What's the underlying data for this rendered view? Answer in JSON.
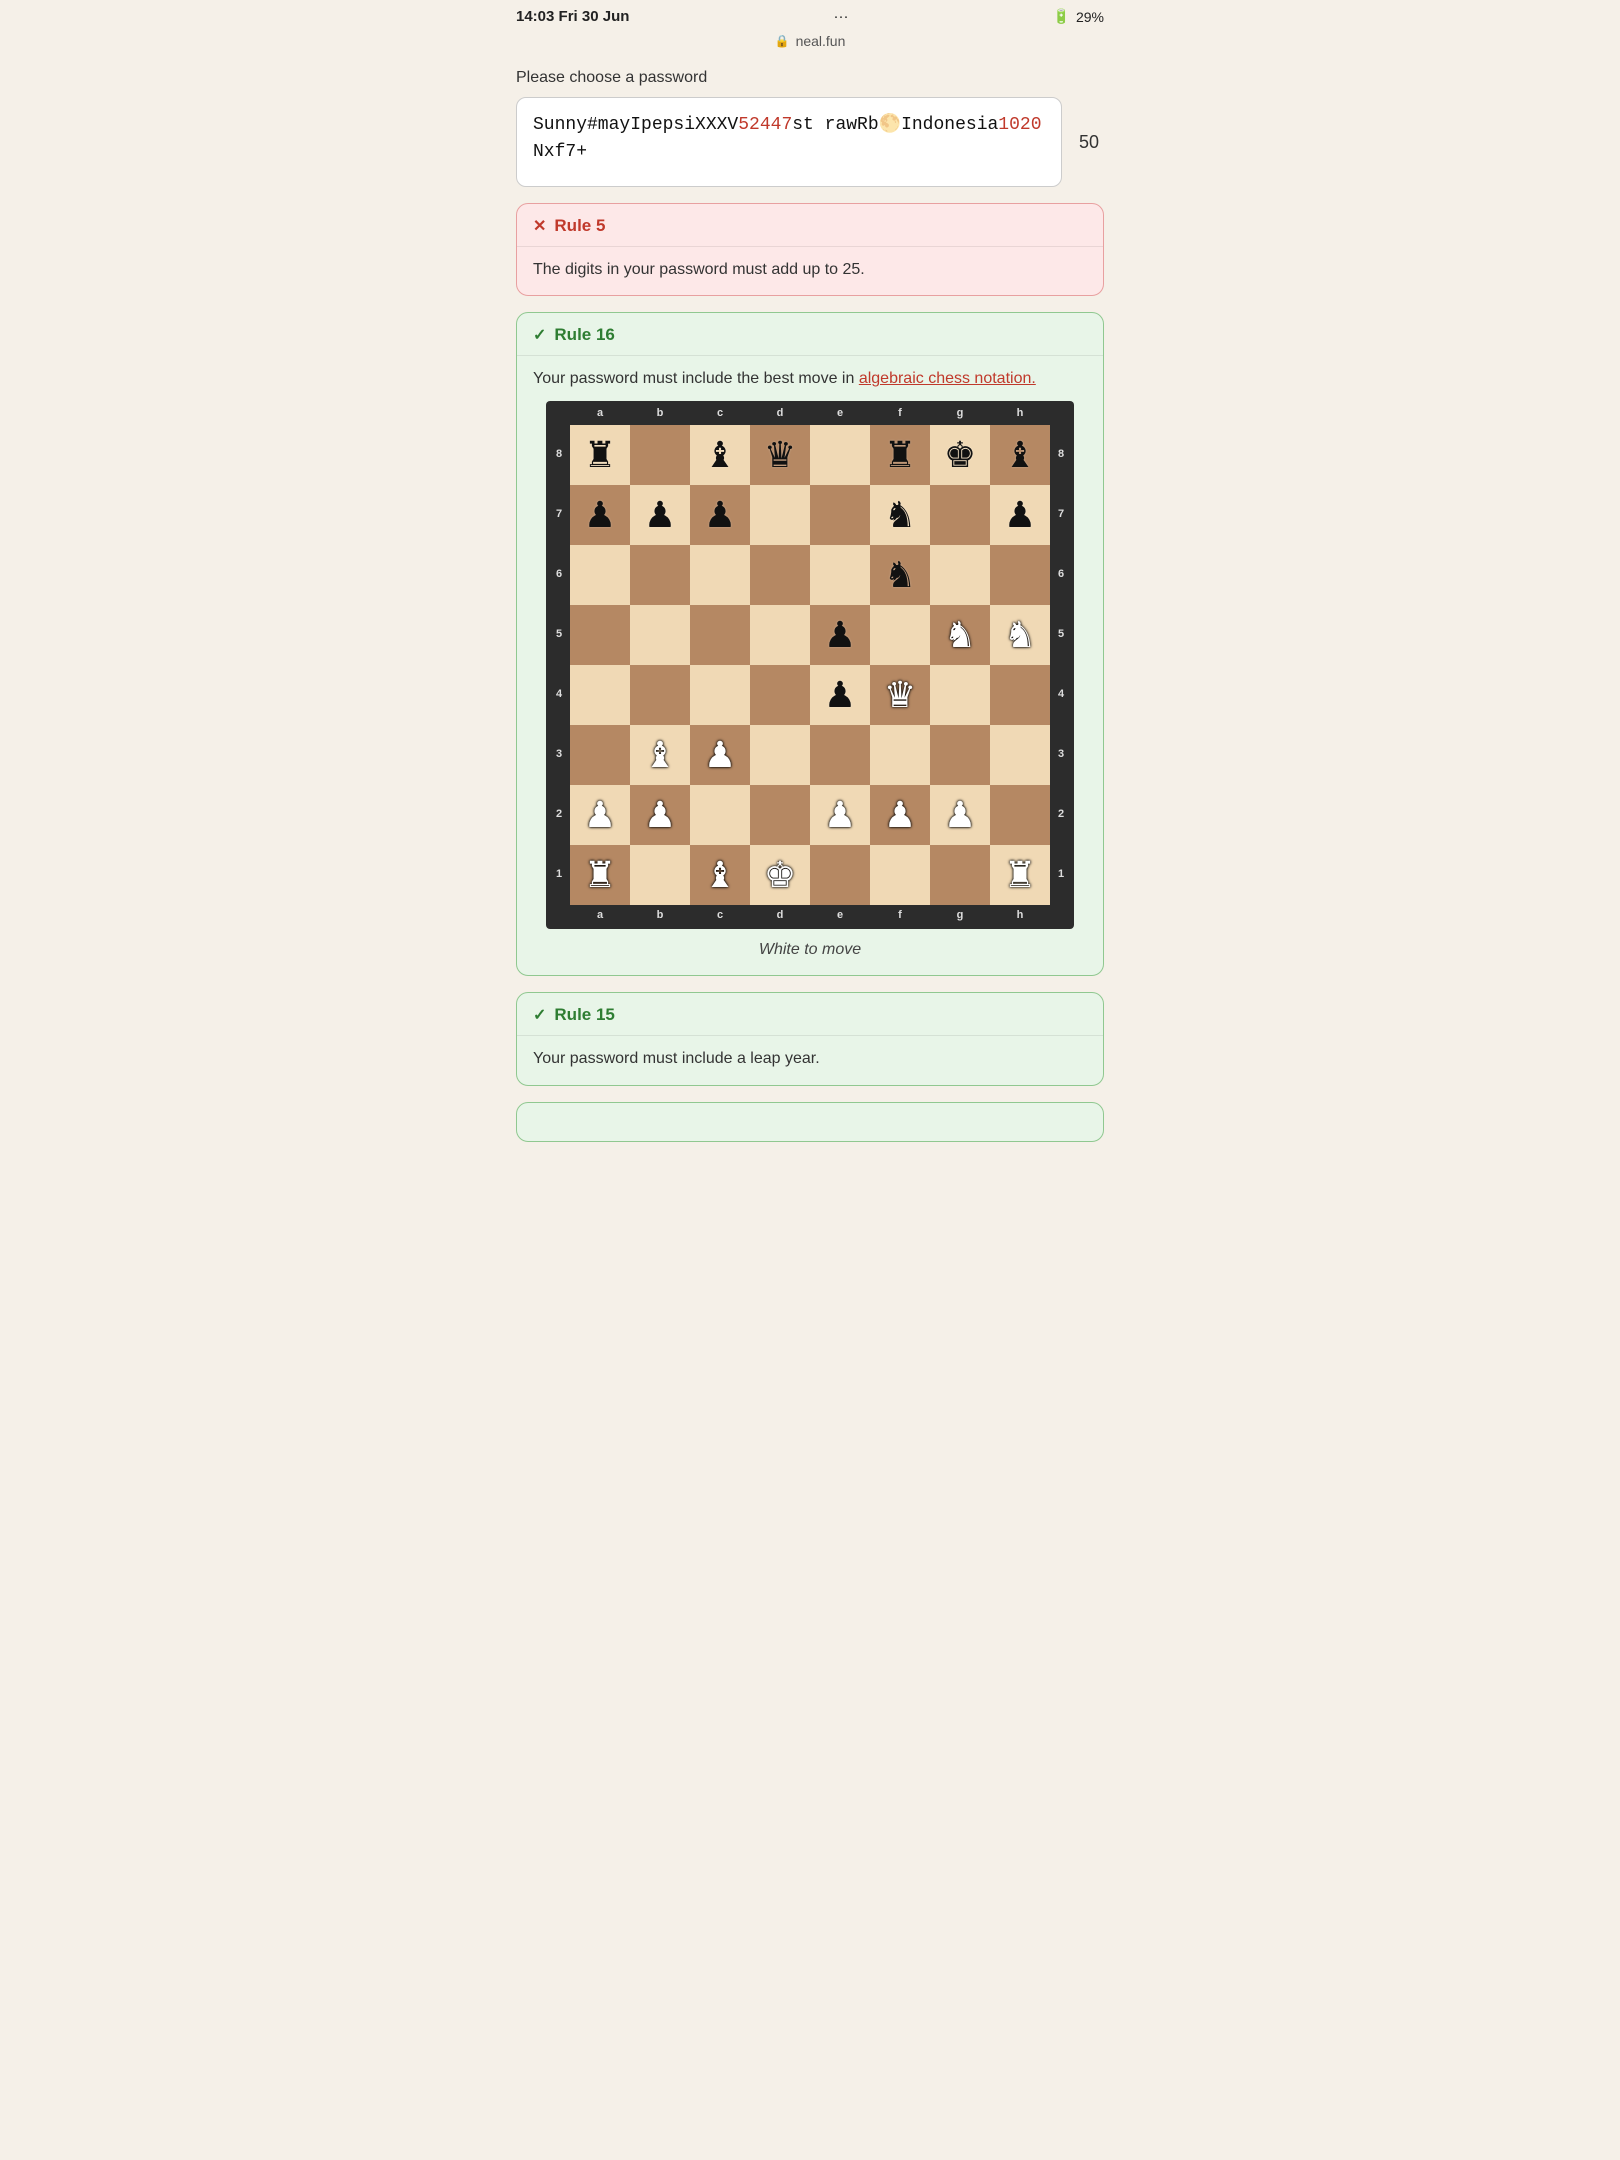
{
  "status_bar": {
    "time": "14:03",
    "date": "Fri 30 Jun",
    "dots": "···",
    "url": "neal.fun",
    "battery": "29%"
  },
  "prompt_label": "Please choose a password",
  "password": {
    "text_parts": [
      {
        "text": "Sunny#mayIpepsiXXXV",
        "highlight": false
      },
      {
        "text": "52447",
        "highlight": true
      },
      {
        "text": "strawRb🌕Indonesia",
        "highlight": false
      },
      {
        "text": "1020",
        "highlight": true
      },
      {
        "text": "Nxf7+",
        "highlight": false
      }
    ],
    "display": "Sunny#mayIpepsiXXXV52447strawRb🌕Indonesia1020Nxf7+",
    "char_count": "50"
  },
  "rules": [
    {
      "id": "rule5",
      "number": "Rule 5",
      "status": "fail",
      "icon_fail": "✕",
      "icon_pass": "✓",
      "body": "The digits in your password must add up to 25."
    },
    {
      "id": "rule16",
      "number": "Rule 16",
      "status": "pass",
      "icon_pass": "✓",
      "body_prefix": "Your password must include the best move in ",
      "link_text": "algebraic chess notation.",
      "body_suffix": "",
      "caption": "White to move"
    },
    {
      "id": "rule15",
      "number": "Rule 15",
      "status": "pass",
      "icon_pass": "✓",
      "body": "Your password must include a leap year."
    }
  ],
  "chess": {
    "col_labels": [
      "a",
      "b",
      "c",
      "d",
      "e",
      "f",
      "g",
      "h"
    ],
    "row_labels": [
      "8",
      "7",
      "6",
      "5",
      "4",
      "3",
      "2",
      "1"
    ],
    "caption": "White to move",
    "board": [
      [
        "bR",
        "",
        "bB",
        "bQ",
        "",
        "bR",
        "bK",
        "bB"
      ],
      [
        "bP",
        "bP",
        "bP",
        "",
        "",
        "bN",
        "",
        "bP"
      ],
      [
        "",
        "",
        "",
        "",
        "",
        "bN",
        "",
        ""
      ],
      [
        "",
        "",
        "",
        "",
        "bP",
        "",
        "wN",
        "wN"
      ],
      [
        "",
        "",
        "",
        "",
        "bP",
        "wQ",
        "",
        ""
      ],
      [
        "",
        "wB",
        "wP",
        "",
        "",
        "",
        "",
        ""
      ],
      [
        "wP",
        "wP",
        "",
        "",
        "wP",
        "wP",
        "wP",
        ""
      ],
      [
        "wR",
        "",
        "wB",
        "wK",
        "",
        "",
        "",
        "wR"
      ]
    ]
  }
}
